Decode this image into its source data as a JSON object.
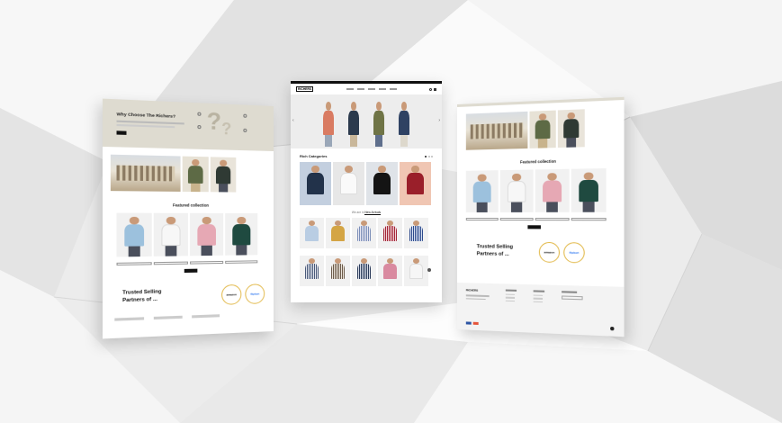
{
  "colors": {
    "backdrop": "#e9e9e9",
    "hero_band": "#dedbd0",
    "accent_gold": "#e2b94a",
    "dark": "#111111"
  },
  "left_panel": {
    "why_title": "Why Choose The Richers?",
    "featured_title": "Featured collection",
    "trusted_line1": "Trusted Selling",
    "trusted_line2": "Partners of ...",
    "amazon_label": "amazon",
    "flipkart_label": "flipkart"
  },
  "center_panel": {
    "brand": "RICHERS",
    "rich_categories": "Rich Categories",
    "we_are_in": "We are in",
    "new_arrivals": "New Arrivals"
  },
  "right_panel": {
    "featured_title": "Featured collection",
    "trusted_line1": "Trusted Selling",
    "trusted_line2": "Partners of ...",
    "amazon_label": "amazon",
    "flipkart_label": "flipkart",
    "footer_brand": "RICHERS"
  },
  "icons": [
    "question-mark-icon",
    "chevron-left-icon",
    "chevron-right-icon",
    "cart-icon",
    "search-icon",
    "whatsapp-icon"
  ]
}
